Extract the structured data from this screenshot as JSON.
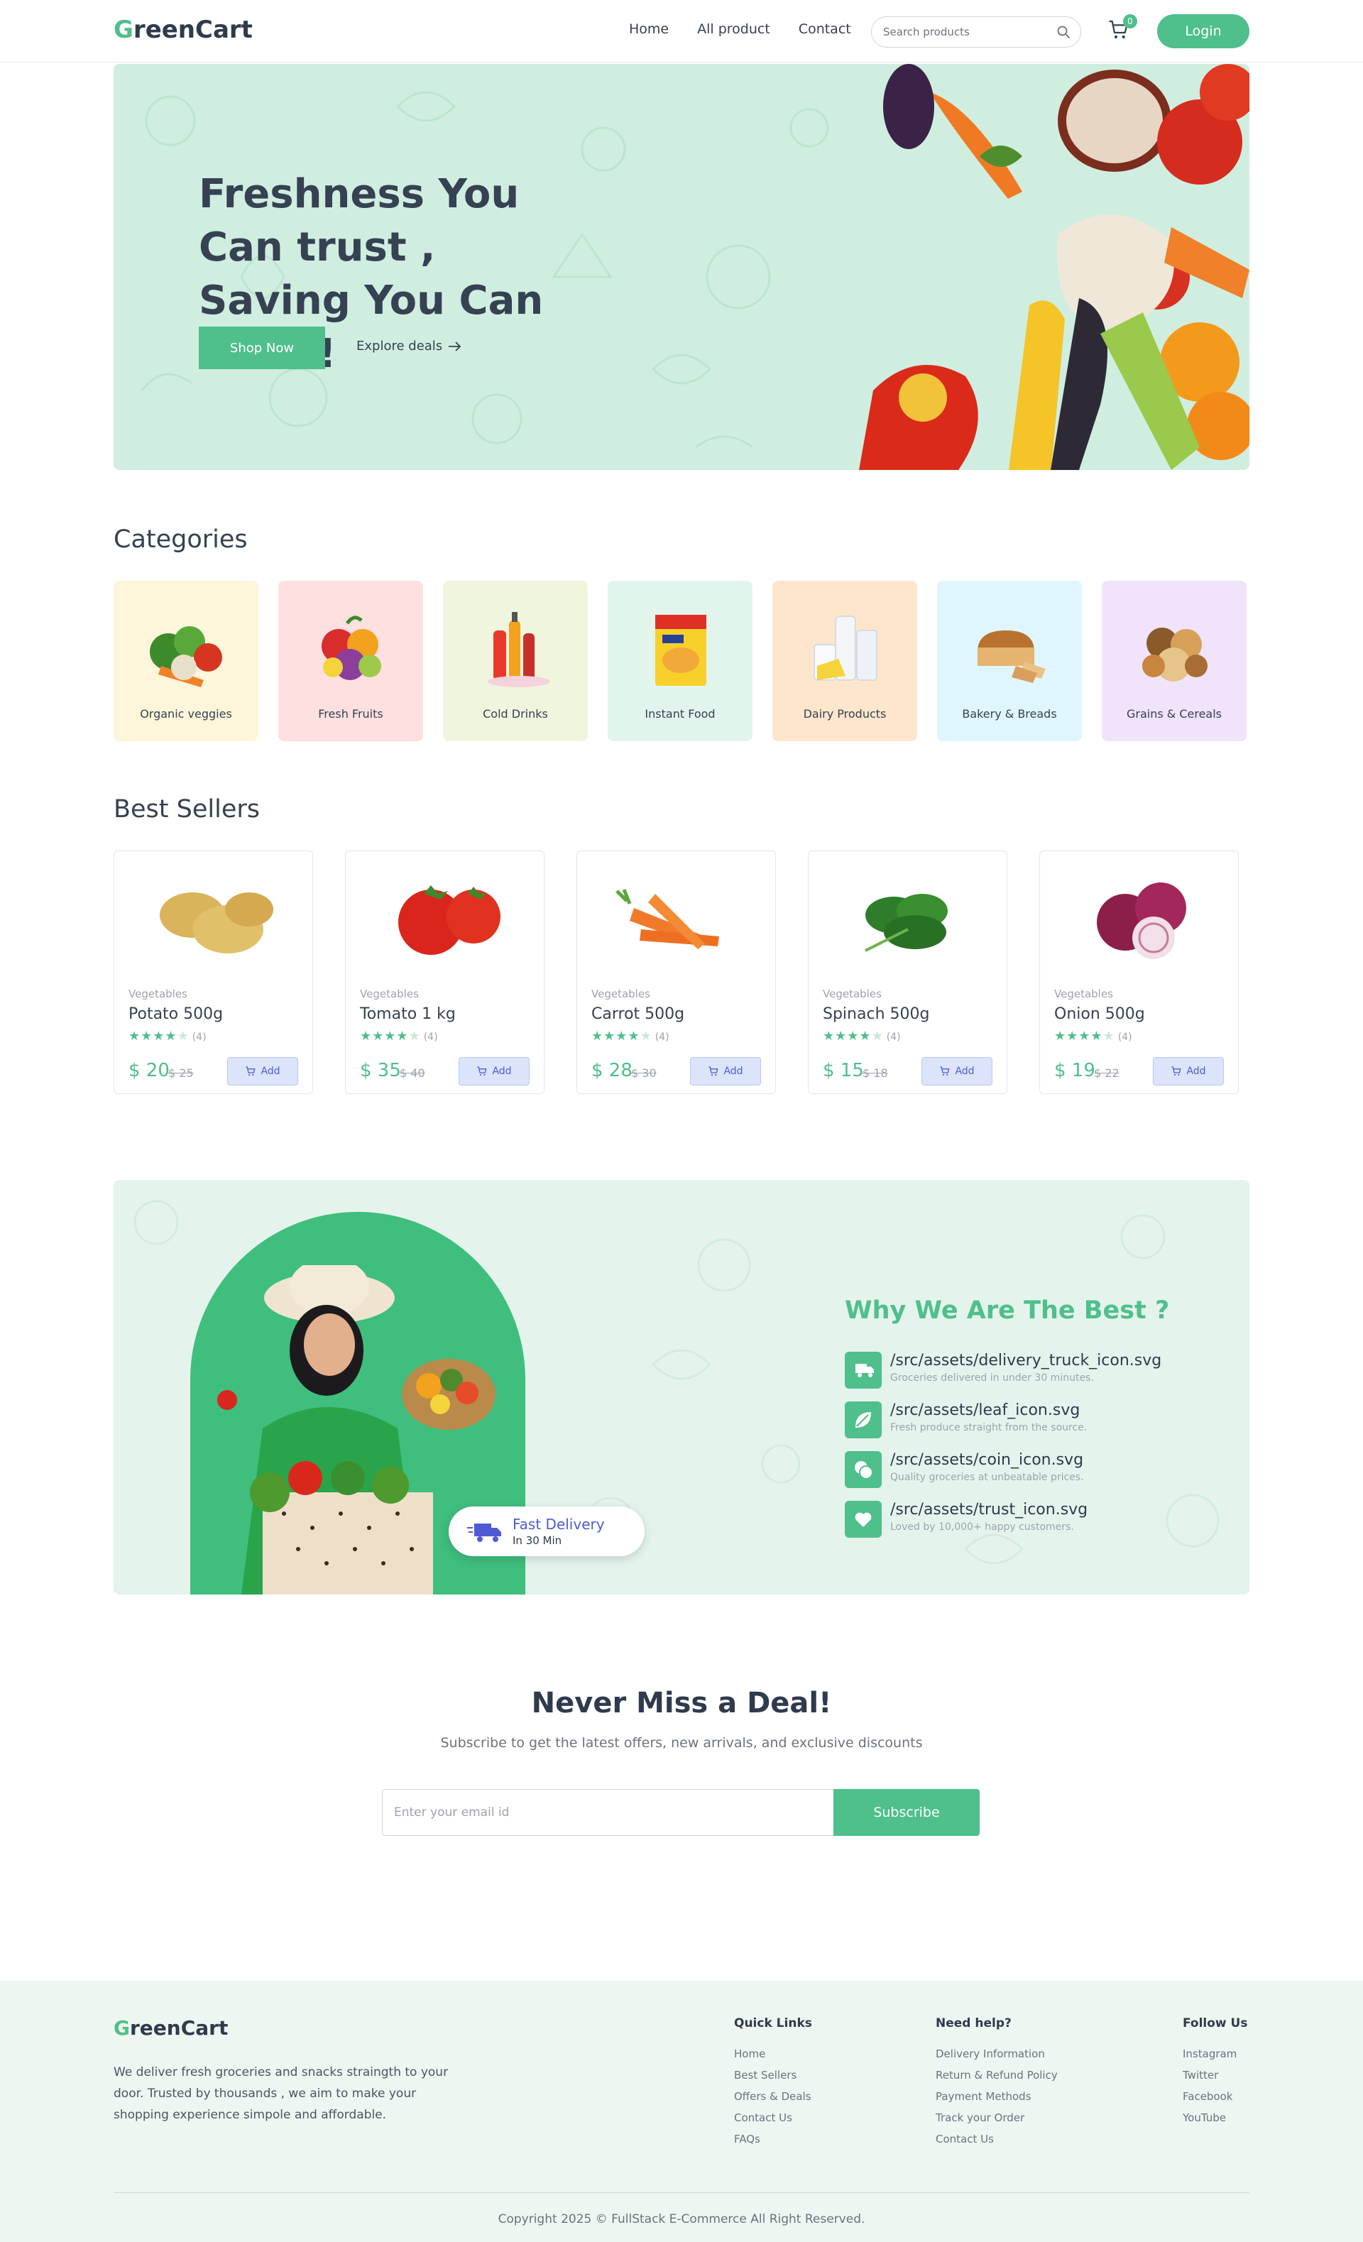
{
  "nav": {
    "logo_first": "G",
    "logo_rest": "reenCart",
    "links": [
      "Home",
      "All product",
      "Contact"
    ],
    "search_placeholder": "Search products",
    "cart_count": "0",
    "login_label": "Login"
  },
  "hero": {
    "title": "Freshness You Can trust , Saving You Can Love !",
    "shop_now": "Shop Now",
    "explore": "Explore deals"
  },
  "categories": {
    "title": "Categories",
    "items": [
      {
        "label": "Organic veggies",
        "bg": "#fef6da"
      },
      {
        "label": "Fresh Fruits",
        "bg": "#fee0e0"
      },
      {
        "label": "Cold Drinks",
        "bg": "#f0f5de"
      },
      {
        "label": "Instant Food",
        "bg": "#e1f5ec"
      },
      {
        "label": "Dairy Products",
        "bg": "#fee6cd"
      },
      {
        "label": "Bakery & Breads",
        "bg": "#e0f6fe"
      },
      {
        "label": "Grains & Cereals",
        "bg": "#f1e3f9"
      }
    ]
  },
  "best_sellers": {
    "title": "Best Sellers",
    "products": [
      {
        "category": "Vegetables",
        "name": "Potato 500g",
        "price": "$ 20",
        "old_price": "$ 25",
        "rating": 4,
        "reviews": "(4)",
        "add": "Add"
      },
      {
        "category": "Vegetables",
        "name": "Tomato 1 kg",
        "price": "$ 35",
        "old_price": "$ 40",
        "rating": 4,
        "reviews": "(4)",
        "add": "Add"
      },
      {
        "category": "Vegetables",
        "name": "Carrot 500g",
        "price": "$ 28",
        "old_price": "$ 30",
        "rating": 4,
        "reviews": "(4)",
        "add": "Add"
      },
      {
        "category": "Vegetables",
        "name": "Spinach 500g",
        "price": "$ 15",
        "old_price": "$ 18",
        "rating": 4,
        "reviews": "(4)",
        "add": "Add"
      },
      {
        "category": "Vegetables",
        "name": "Onion 500g",
        "price": "$ 19",
        "old_price": "$ 22",
        "rating": 4,
        "reviews": "(4)",
        "add": "Add"
      }
    ]
  },
  "why": {
    "title": "Why We Are The Best ?",
    "badge_title": "Fast Delivery",
    "badge_sub": "In 30 Min",
    "items": [
      {
        "name": "/src/assets/delivery_truck_icon.svg",
        "desc": "Groceries delivered in under 30 minutes."
      },
      {
        "name": "/src/assets/leaf_icon.svg",
        "desc": "Fresh produce straight from the source."
      },
      {
        "name": "/src/assets/coin_icon.svg",
        "desc": "Quality groceries at unbeatable prices."
      },
      {
        "name": "/src/assets/trust_icon.svg",
        "desc": "Loved by 10,000+ happy customers."
      }
    ]
  },
  "newsletter": {
    "title": "Never Miss a Deal!",
    "subtitle": "Subscribe to get the latest offers, new arrivals, and exclusive discounts",
    "placeholder": "Enter your email id",
    "button": "Subscribe"
  },
  "footer": {
    "description": "We deliver fresh groceries and snacks straingth to your door. Trusted by thousands , we aim to make your shopping experience simpole and affordable.",
    "columns": [
      {
        "title": "Quick Links",
        "links": [
          "Home",
          "Best Sellers",
          "Offers & Deals",
          "Contact Us",
          "FAQs"
        ]
      },
      {
        "title": "Need help?",
        "links": [
          "Delivery Information",
          "Return & Refund Policy",
          "Payment Methods",
          "Track your Order",
          "Contact Us"
        ]
      },
      {
        "title": "Follow Us",
        "links": [
          "Instagram",
          "Twitter",
          "Facebook",
          "YouTube"
        ]
      }
    ],
    "copyright": "Copyright 2025 © FullStack E-Commerce All Right Reserved."
  },
  "colors": {
    "brand": "#4fbf8b",
    "text": "#364152",
    "add_button_text": "#4f5bd5"
  }
}
